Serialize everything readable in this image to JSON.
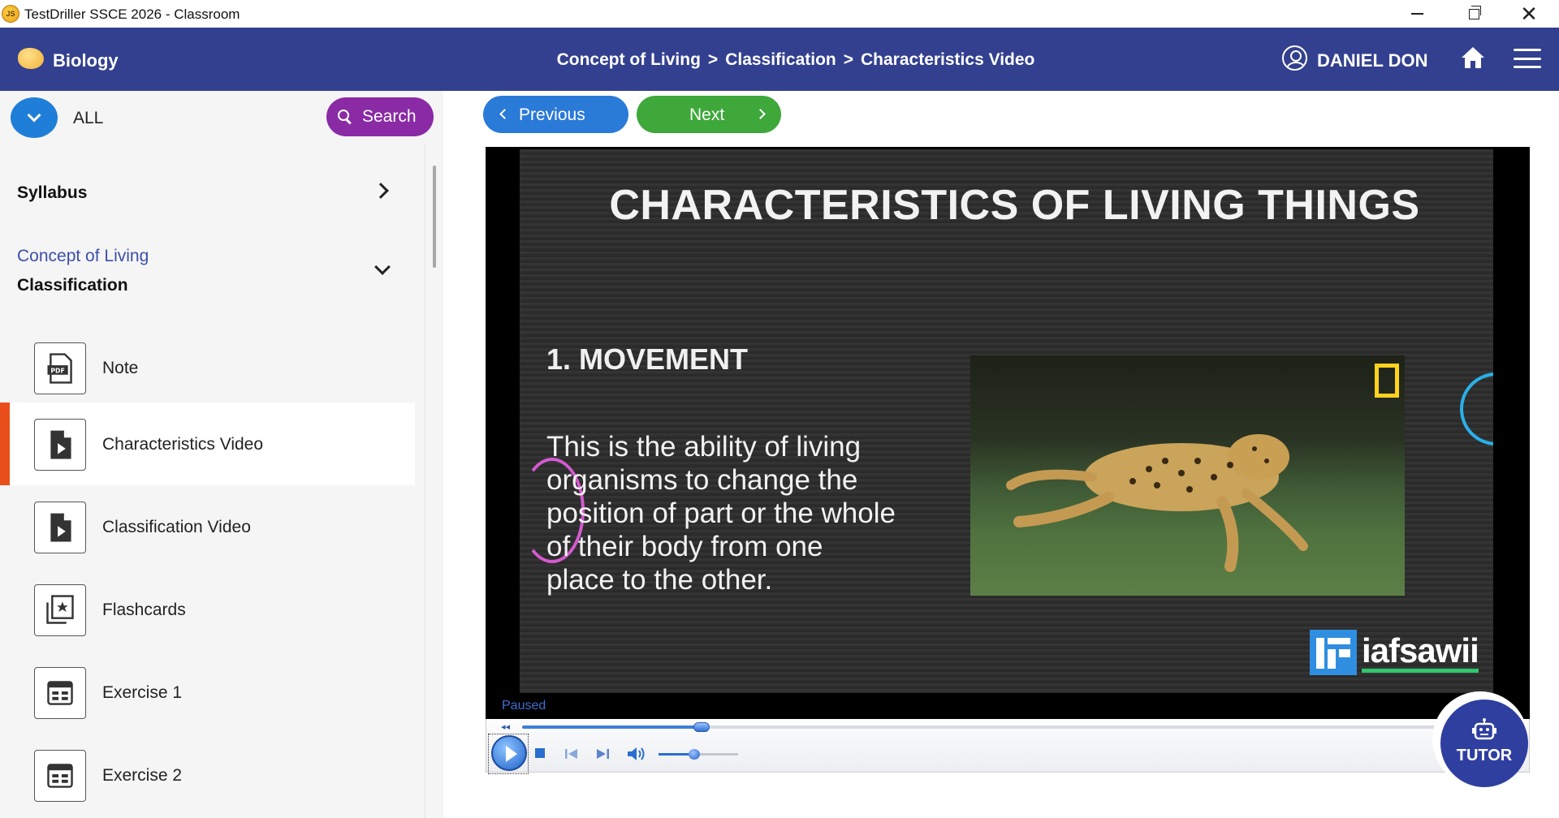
{
  "window": {
    "icon_text": "JS",
    "title": "TestDriller SSCE 2026 - Classroom"
  },
  "header": {
    "subject": "Biology",
    "breadcrumb": [
      "Concept of Living",
      "Classification",
      "Characteristics Video"
    ],
    "breadcrumb_separator": ">",
    "user_name": "DANIEL DON"
  },
  "sidebar": {
    "filter_label": "ALL",
    "search_label": "Search",
    "syllabus_label": "Syllabus",
    "topic": "Concept of Living",
    "subtopic": "Classification",
    "items": [
      {
        "label": "Note",
        "icon": "pdf-icon"
      },
      {
        "label": "Characteristics Video",
        "icon": "video-file-icon",
        "active": true
      },
      {
        "label": "Classification Video",
        "icon": "video-file-icon"
      },
      {
        "label": "Flashcards",
        "icon": "flashcards-icon"
      },
      {
        "label": "Exercise 1",
        "icon": "exercise-icon"
      },
      {
        "label": "Exercise 2",
        "icon": "exercise-icon"
      }
    ]
  },
  "nav": {
    "previous_label": "Previous",
    "next_label": "Next"
  },
  "video": {
    "slide_title": "CHARACTERISTICS OF LIVING THINGS",
    "slide_heading": "1. MOVEMENT",
    "slide_body": "This is the ability of living organisms to change the position of part or the whole of their body from one place to the other.",
    "watermark": "iafsawii",
    "status": "Paused",
    "progress": 0.18,
    "volume": 0.45
  },
  "tutor": {
    "label": "TUTOR"
  },
  "colors": {
    "header_bg": "#33408f",
    "prev_button": "#2a7ad8",
    "next_button": "#3ea83a",
    "search_button": "#8a2aa5",
    "active_marker": "#ea4f1b",
    "tutor_bg": "#2f3fa0"
  }
}
